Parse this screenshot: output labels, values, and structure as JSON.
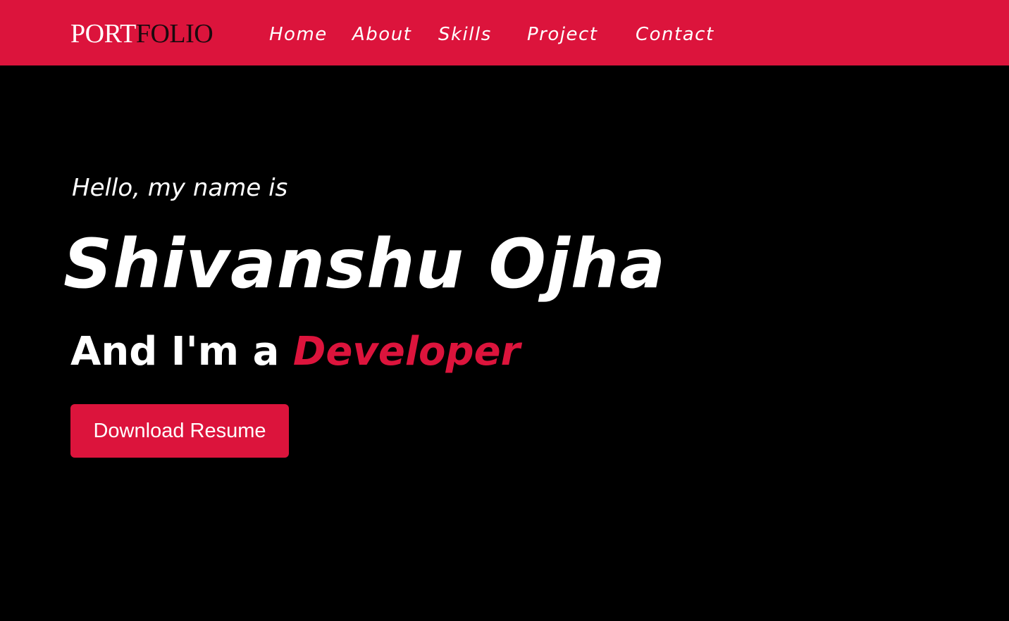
{
  "header": {
    "logo": {
      "part_a": "PORT",
      "part_b": "FOLIO"
    },
    "nav": [
      {
        "label": "Home"
      },
      {
        "label": "About"
      },
      {
        "label": "Skills"
      },
      {
        "label": "Project"
      },
      {
        "label": "Contact"
      }
    ]
  },
  "hero": {
    "greeting": "Hello, my name is",
    "name": "Shivanshu Ojha",
    "role_prefix": "And I'm a",
    "role_highlight": "Developer",
    "cta_label": "Download Resume"
  },
  "colors": {
    "accent": "#dc143c",
    "background": "#000000",
    "text": "#ffffff",
    "logo_dark": "#1a0a0e"
  }
}
